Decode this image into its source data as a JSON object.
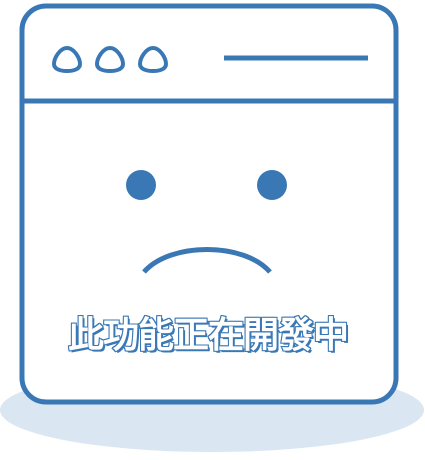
{
  "message": {
    "text": "此功能正在開發中"
  },
  "icons": {
    "window": "browser-window-icon",
    "dots": [
      "window-dot-icon",
      "window-dot-icon",
      "window-dot-icon"
    ],
    "titlebar_line": "title-bar-line-icon",
    "face": "sad-face-icon"
  },
  "colors": {
    "accent": "#3a78b5",
    "shadow": "#dbe6f3",
    "window_fill": "#ffffff"
  }
}
